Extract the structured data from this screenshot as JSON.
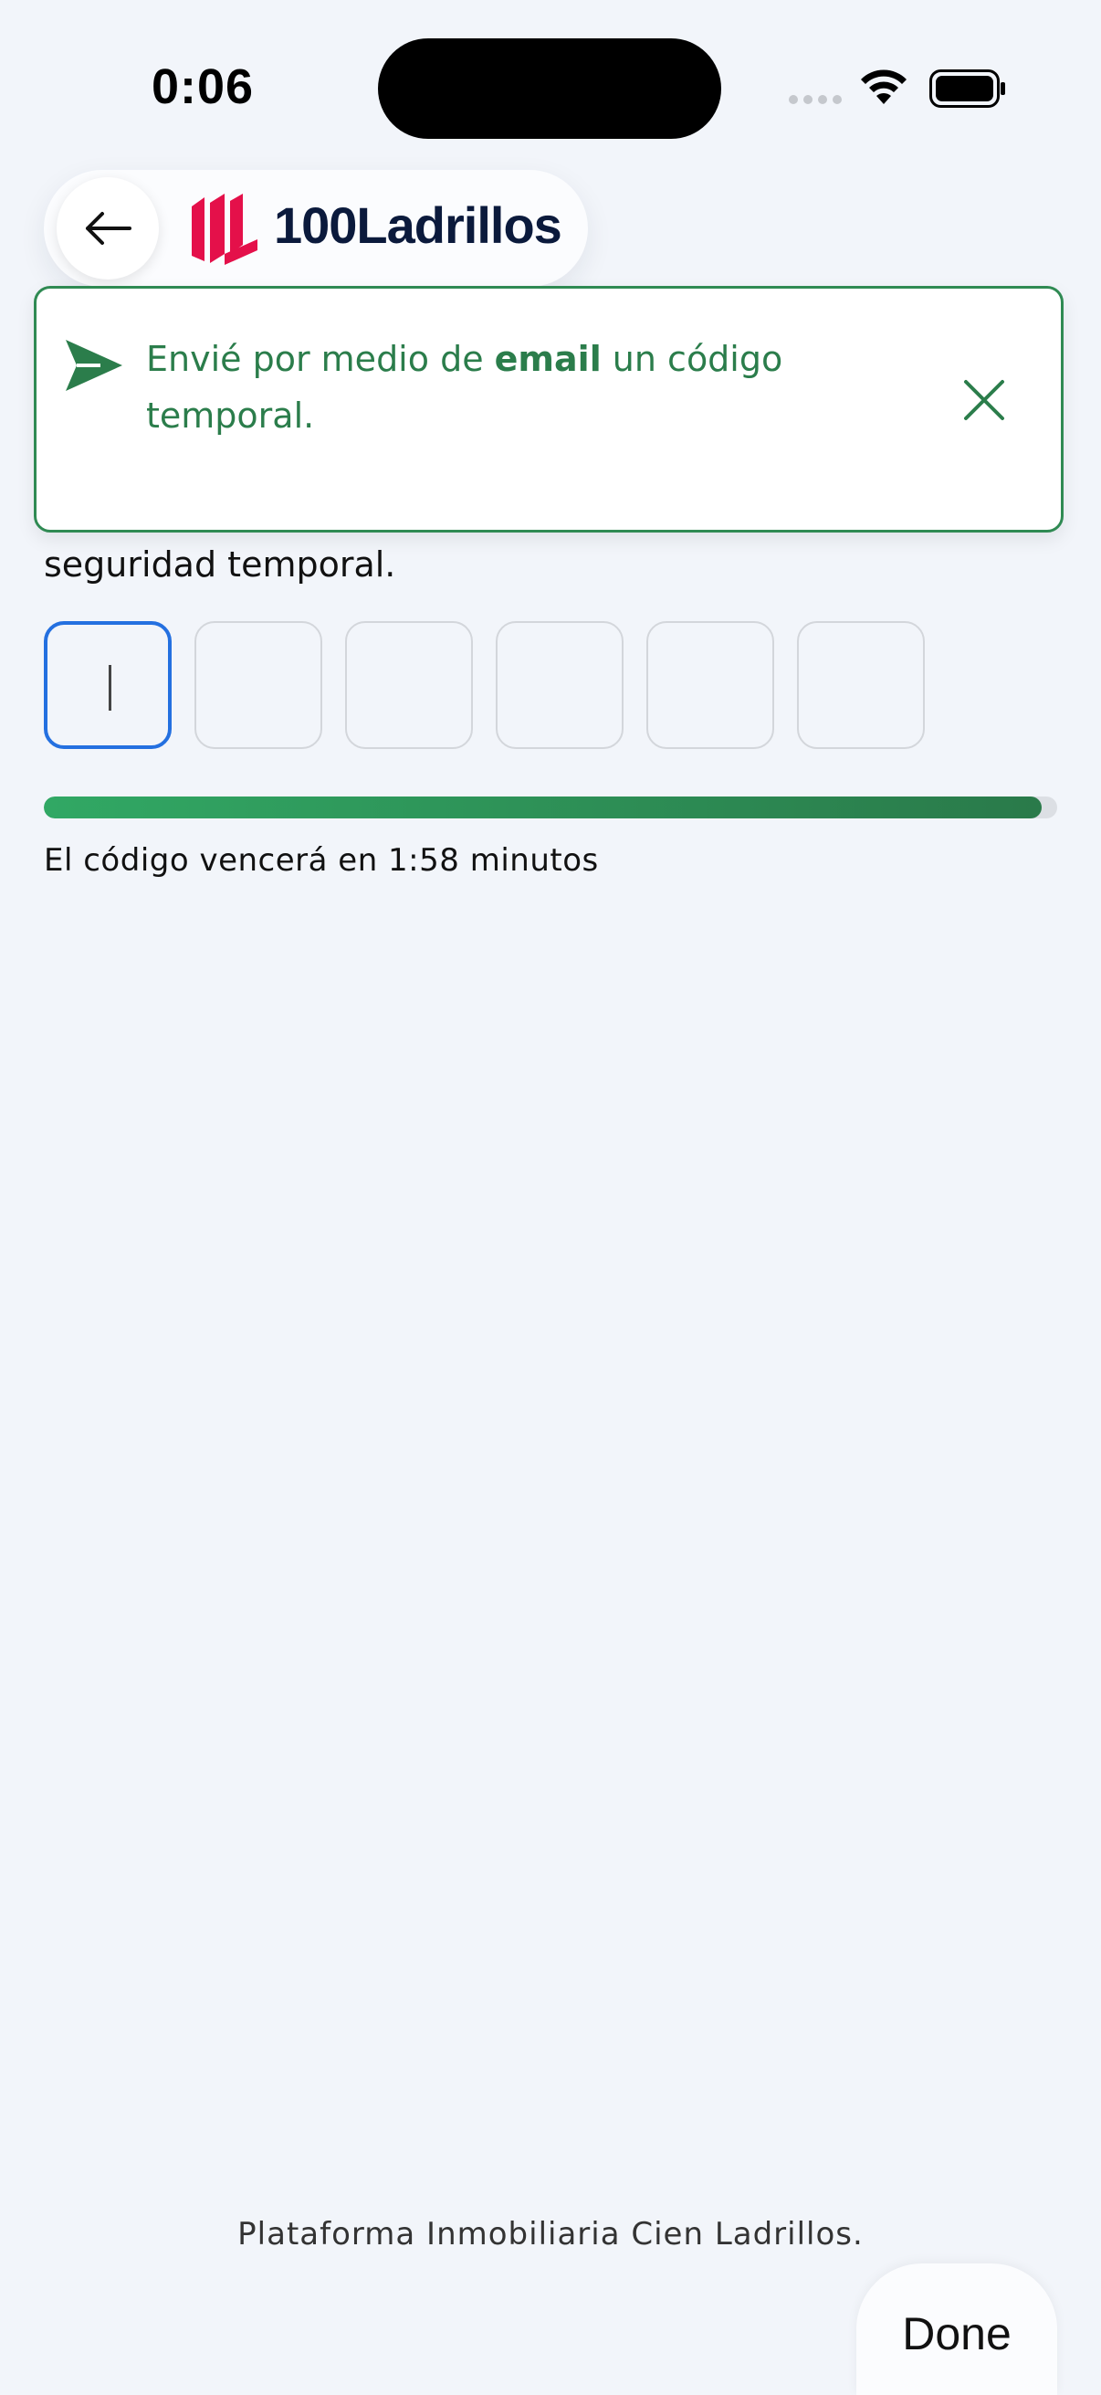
{
  "status_bar": {
    "time": "0:06"
  },
  "header": {
    "brand": "100Ladrillos"
  },
  "toast": {
    "text_before": "Envié por medio de ",
    "text_bold": "email",
    "text_after": " un código temporal.",
    "accent_color": "#2b7d4b"
  },
  "form": {
    "instruction_visible": "seguridad temporal.",
    "otp_length": 6,
    "active_index": 0
  },
  "timer": {
    "remaining_fraction": 0.985,
    "text": "El código vencerá en 1:58 minutos"
  },
  "footer": {
    "text": "Plataforma Inmobiliaria Cien Ladrillos."
  },
  "keyboard_toolbar": {
    "done_label": "Done"
  },
  "icons": {
    "back": "arrow-left-icon",
    "send": "paper-plane-icon",
    "close": "close-icon",
    "wifi": "wifi-icon",
    "battery": "battery-icon"
  }
}
